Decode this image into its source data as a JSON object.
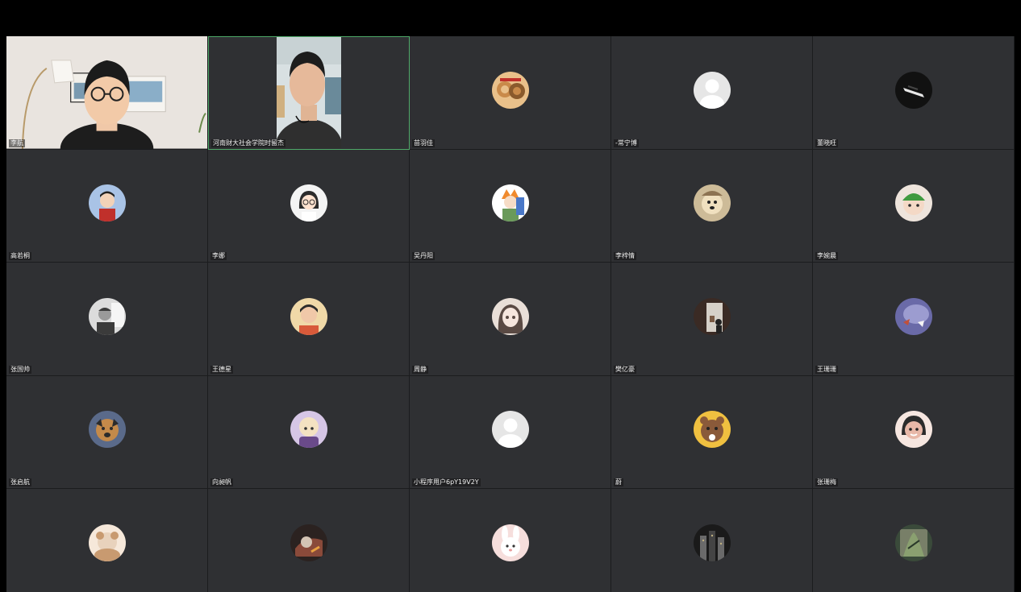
{
  "meeting": {
    "participants": [
      {
        "name": "李航",
        "type": "video-self"
      },
      {
        "name": "河南财大社会学院时留杰",
        "type": "video-portrait",
        "active": true
      },
      {
        "name": "苗羽佳",
        "type": "avatar",
        "avatar_icon": "cats-avatar-icon",
        "colors": [
          "#c98a4a",
          "#e9c08a",
          "#8a5a2c"
        ]
      },
      {
        "name": "-常宁博",
        "type": "avatar",
        "avatar_icon": "default-user-avatar-icon",
        "colors": [
          "#e6e6e6",
          "#ffffff",
          "#bdbdbd"
        ]
      },
      {
        "name": "董晓旺",
        "type": "avatar",
        "avatar_icon": "dark-object-avatar-icon",
        "colors": [
          "#111111",
          "#e8e8e8",
          "#444444"
        ]
      },
      {
        "name": "高若桐",
        "type": "avatar",
        "avatar_icon": "child-photo-avatar-icon",
        "colors": [
          "#a9c3e6",
          "#222222",
          "#c0302b"
        ]
      },
      {
        "name": "李娜",
        "type": "avatar",
        "avatar_icon": "cartoon-girl-avatar-icon",
        "colors": [
          "#f4f4f4",
          "#2b2b2b",
          "#ffe2cf"
        ]
      },
      {
        "name": "吴丹阳",
        "type": "avatar",
        "avatar_icon": "anime-boy-avatar-icon",
        "colors": [
          "#ffffff",
          "#f08a2d",
          "#4a78c8"
        ]
      },
      {
        "name": "李梓情",
        "type": "avatar",
        "avatar_icon": "dog-avatar-icon",
        "colors": [
          "#cdbb98",
          "#f0e0bf",
          "#8d7352"
        ]
      },
      {
        "name": "李婉晨",
        "type": "avatar",
        "avatar_icon": "baby-hat-avatar-icon",
        "colors": [
          "#f4d9c6",
          "#3f9a3f",
          "#2b2b2b"
        ]
      },
      {
        "name": "张国帅",
        "type": "avatar",
        "avatar_icon": "bw-portrait-avatar-icon",
        "colors": [
          "#dcdcdc",
          "#3b3b3b",
          "#f5f5f5"
        ]
      },
      {
        "name": "王德星",
        "type": "avatar",
        "avatar_icon": "boy-photo-avatar-icon",
        "colors": [
          "#f0d9a8",
          "#2b2b2b",
          "#d85a3a"
        ]
      },
      {
        "name": "周静",
        "type": "avatar",
        "avatar_icon": "girl-drawing-avatar-icon",
        "colors": [
          "#e9dfd8",
          "#5a4a44",
          "#c9b5ab"
        ]
      },
      {
        "name": "樊亿豪",
        "type": "avatar",
        "avatar_icon": "room-scene-avatar-icon",
        "colors": [
          "#3a2a24",
          "#d6d0c8",
          "#7a5a44"
        ]
      },
      {
        "name": "王珊珊",
        "type": "avatar",
        "avatar_icon": "purple-art-avatar-icon",
        "colors": [
          "#6a6aa8",
          "#9c9cd0",
          "#c0503a"
        ]
      },
      {
        "name": "张启航",
        "type": "avatar",
        "avatar_icon": "dog-photo-avatar-icon",
        "colors": [
          "#5a6a8a",
          "#c48a4a",
          "#2b2b2b"
        ]
      },
      {
        "name": "向昶帆",
        "type": "avatar",
        "avatar_icon": "cartoon-bald-avatar-icon",
        "colors": [
          "#d6c6e6",
          "#f4e2c2",
          "#6a4a8a"
        ]
      },
      {
        "name": "小程序用户6pY19V2Y",
        "type": "avatar",
        "avatar_icon": "default-user-avatar-icon",
        "colors": [
          "#e6e6e6",
          "#ffffff",
          "#bdbdbd"
        ]
      },
      {
        "name": "蔚",
        "type": "avatar",
        "avatar_icon": "bear-avatar-icon",
        "colors": [
          "#f0c040",
          "#8a5a3a",
          "#ffffff"
        ]
      },
      {
        "name": "张珊梅",
        "type": "avatar",
        "avatar_icon": "little-girl-avatar-icon",
        "colors": [
          "#f6e6e0",
          "#2b2b2b",
          "#e8b8a8"
        ]
      },
      {
        "name": "",
        "type": "avatar",
        "avatar_icon": "toy-dog-avatar-icon",
        "colors": [
          "#e8d2bc",
          "#c89a70",
          "#f6e8da"
        ]
      },
      {
        "name": "",
        "type": "avatar",
        "avatar_icon": "dark-photo-avatar-icon",
        "colors": [
          "#2b2220",
          "#d4c4b4",
          "#8a4a3a"
        ]
      },
      {
        "name": "",
        "type": "avatar",
        "avatar_icon": "bunny-avatar-icon",
        "colors": [
          "#f6dedc",
          "#ffffff",
          "#e89a9a"
        ]
      },
      {
        "name": "",
        "type": "avatar",
        "avatar_icon": "night-city-avatar-icon",
        "colors": [
          "#1a1a1a",
          "#6a6a6a",
          "#c0b080"
        ]
      },
      {
        "name": "",
        "type": "avatar",
        "avatar_icon": "plant-photo-avatar-icon",
        "colors": [
          "#3a4a3a",
          "#8aa070",
          "#d6d0b0"
        ]
      }
    ]
  },
  "colors": {
    "tile_bg": "#2f3033",
    "active_border": "#4ea868",
    "page_bg": "#000000"
  }
}
